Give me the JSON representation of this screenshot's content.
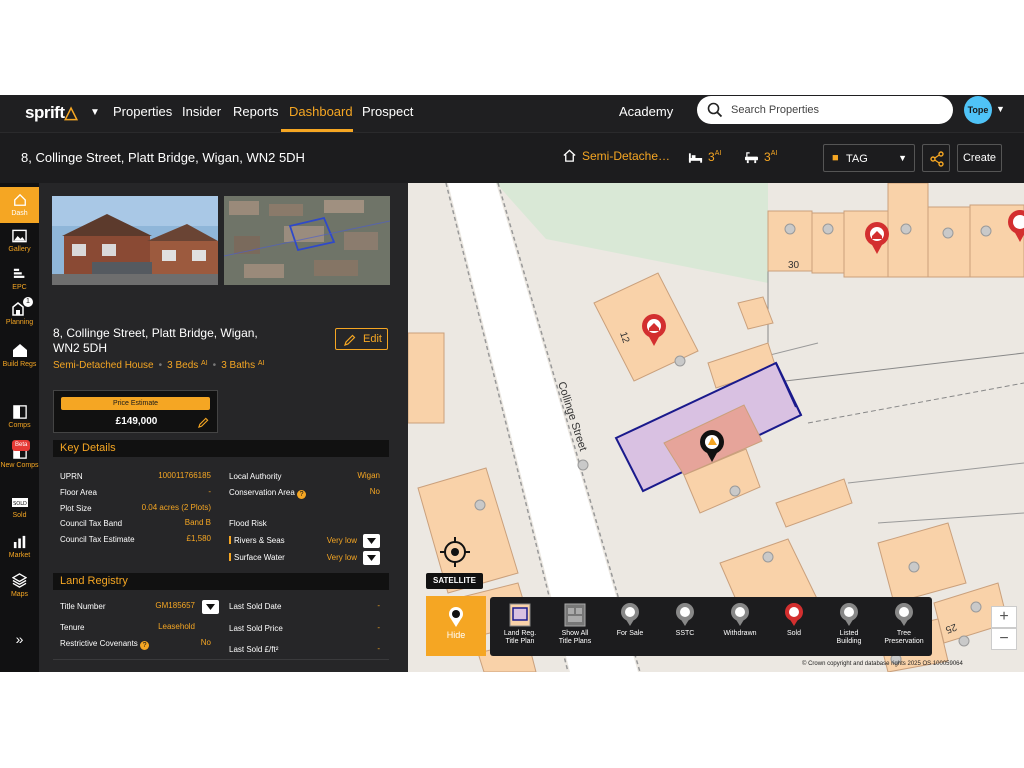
{
  "nav": {
    "logo_text": "sprift",
    "items": [
      "Properties",
      "Insider",
      "Reports",
      "Dashboard",
      "Prospect"
    ],
    "active": "Dashboard",
    "academy": "Academy",
    "search_placeholder": "Search Properties",
    "avatar_text": "Tope"
  },
  "property": {
    "address": "8, Collinge Street, Platt Bridge, Wigan, WN2 5DH",
    "address_line1": "8, Collinge Street, Platt Bridge, Wigan,",
    "address_line2": "WN2 5DH",
    "type_short": "Semi-Detache…",
    "type": "Semi-Detached House",
    "beds": "3",
    "baths": "3",
    "beds_label": "3 Beds",
    "baths_label": "3 Baths",
    "ai_tag": "AI"
  },
  "header_actions": {
    "tag": "TAG",
    "create": "Create",
    "edit": "Edit"
  },
  "price": {
    "label": "Price Estimate",
    "value": "£149,000"
  },
  "rail": [
    "Dash",
    "Gallery",
    "EPC",
    "Planning",
    "Build Regs",
    "Comps",
    "New Comps",
    "Sold",
    "Market",
    "Maps"
  ],
  "rail_beta": "Beta",
  "rail_badge": "1",
  "key_details": {
    "title": "Key Details",
    "uprn_label": "UPRN",
    "uprn": "100011766185",
    "floor_area_label": "Floor Area",
    "floor_area": "-",
    "plot_size_label": "Plot Size",
    "plot_size": "0.04 acres (2 Plots)",
    "council_tax_band_label": "Council Tax Band",
    "council_tax_band": "Band B",
    "council_tax_est_label": "Council Tax Estimate",
    "council_tax_est": "£1,580",
    "local_authority_label": "Local Authority",
    "local_authority": "Wigan",
    "conservation_label": "Conservation Area",
    "conservation": "No",
    "flood_label": "Flood Risk",
    "rivers_label": "Rivers & Seas",
    "rivers": "Very low",
    "surface_label": "Surface Water",
    "surface": "Very low"
  },
  "land_registry": {
    "title": "Land Registry",
    "title_number_label": "Title Number",
    "title_number": "GM185657",
    "tenure_label": "Tenure",
    "tenure": "Leasehold",
    "covenants_label": "Restrictive Covenants",
    "covenants": "No",
    "last_sold_date_label": "Last Sold Date",
    "last_sold_date": "-",
    "last_sold_price_label": "Last Sold Price",
    "last_sold_price": "-",
    "last_sold_sqft_label": "Last Sold £/ft²",
    "last_sold_sqft": "-"
  },
  "map": {
    "street": "Collinge Street",
    "num_12": "12",
    "num_30": "30",
    "num_25": "25",
    "satellite": "SATELLITE",
    "hide": "Hide",
    "copyright": "© Crown copyright and database rights 2025 OS 100059064",
    "layers": [
      "Land Reg. Title Plan",
      "Show All Title Plans",
      "For Sale",
      "SSTC",
      "Withdrawn",
      "Sold",
      "Listed Building",
      "Tree Preservation"
    ],
    "layer_lines": [
      [
        "Land Reg.",
        "Title Plan"
      ],
      [
        "Show All",
        "Title Plans"
      ],
      [
        "For Sale"
      ],
      [
        "SSTC"
      ],
      [
        "Withdrawn"
      ],
      [
        "Sold"
      ],
      [
        "Listed",
        "Building"
      ],
      [
        "Tree",
        "Preservation"
      ]
    ],
    "zoom_in": "+",
    "zoom_out": "−"
  },
  "colors": {
    "accent": "#f5a623",
    "dark": "#1c1c1e",
    "panel": "#262628",
    "building": "#f9d2a9",
    "title_plan": "#1a1a8c"
  }
}
